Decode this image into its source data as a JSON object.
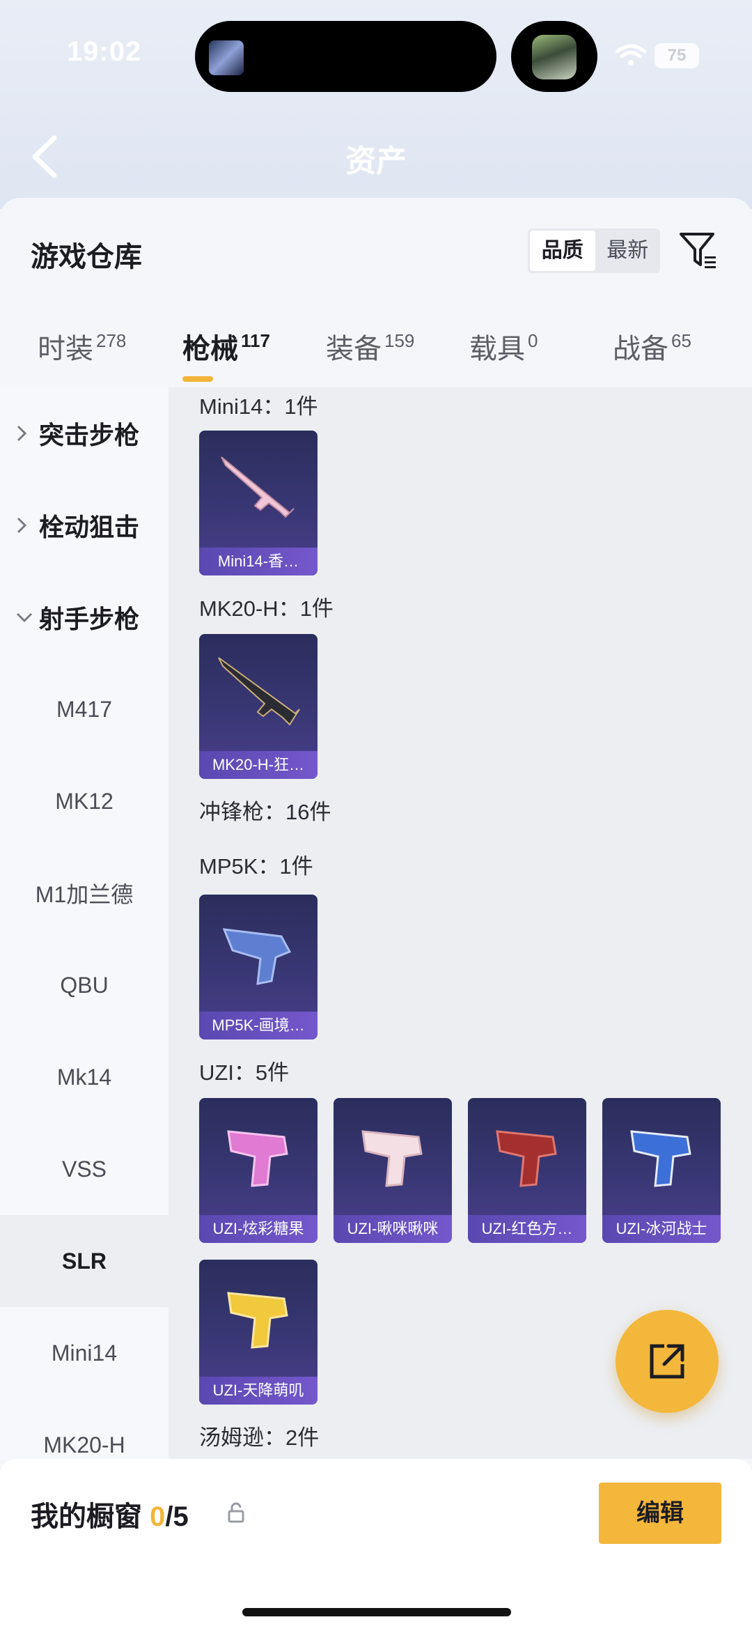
{
  "status": {
    "time": "19:02",
    "battery": "75"
  },
  "nav": {
    "title": "资产"
  },
  "header": {
    "title": "游戏仓库",
    "sort_options": [
      "品质",
      "最新"
    ]
  },
  "tabs": [
    {
      "label": "时装",
      "count": "278"
    },
    {
      "label": "枪械",
      "count": "117"
    },
    {
      "label": "装备",
      "count": "159"
    },
    {
      "label": "载具",
      "count": "0"
    },
    {
      "label": "战备",
      "count": "65"
    }
  ],
  "sidebar": {
    "groups": [
      "突击步枪",
      "栓动狙击",
      "射手步枪"
    ],
    "items": [
      "M417",
      "MK12",
      "M1加兰德",
      "QBU",
      "Mk14",
      "VSS",
      "SLR",
      "Mini14",
      "MK20-H"
    ]
  },
  "sections": {
    "mini14": "Mini14：1件",
    "mk20h": "MK20-H：1件",
    "smg": "冲锋枪：16件",
    "mp5k": "MP5K：1件",
    "uzi": "UZI：5件",
    "thompson": "汤姆逊：2件"
  },
  "cards": {
    "mini14": "Mini14-香…",
    "mk20h": "MK20-H-狂…",
    "mp5k": "MP5K-画境…",
    "uzi1": "UZI-炫彩糖果",
    "uzi2": "UZI-啾咪啾咪",
    "uzi3": "UZI-红色方…",
    "uzi4": "UZI-冰河战士",
    "uzi5": "UZI-天降萌叽"
  },
  "bottom": {
    "label": "我的橱窗",
    "current": "0",
    "total": "/5",
    "edit": "编辑"
  },
  "colors": {
    "accent": "#f2b53a",
    "card_bg": "#3a3775",
    "card_label": "#6a52c0"
  }
}
